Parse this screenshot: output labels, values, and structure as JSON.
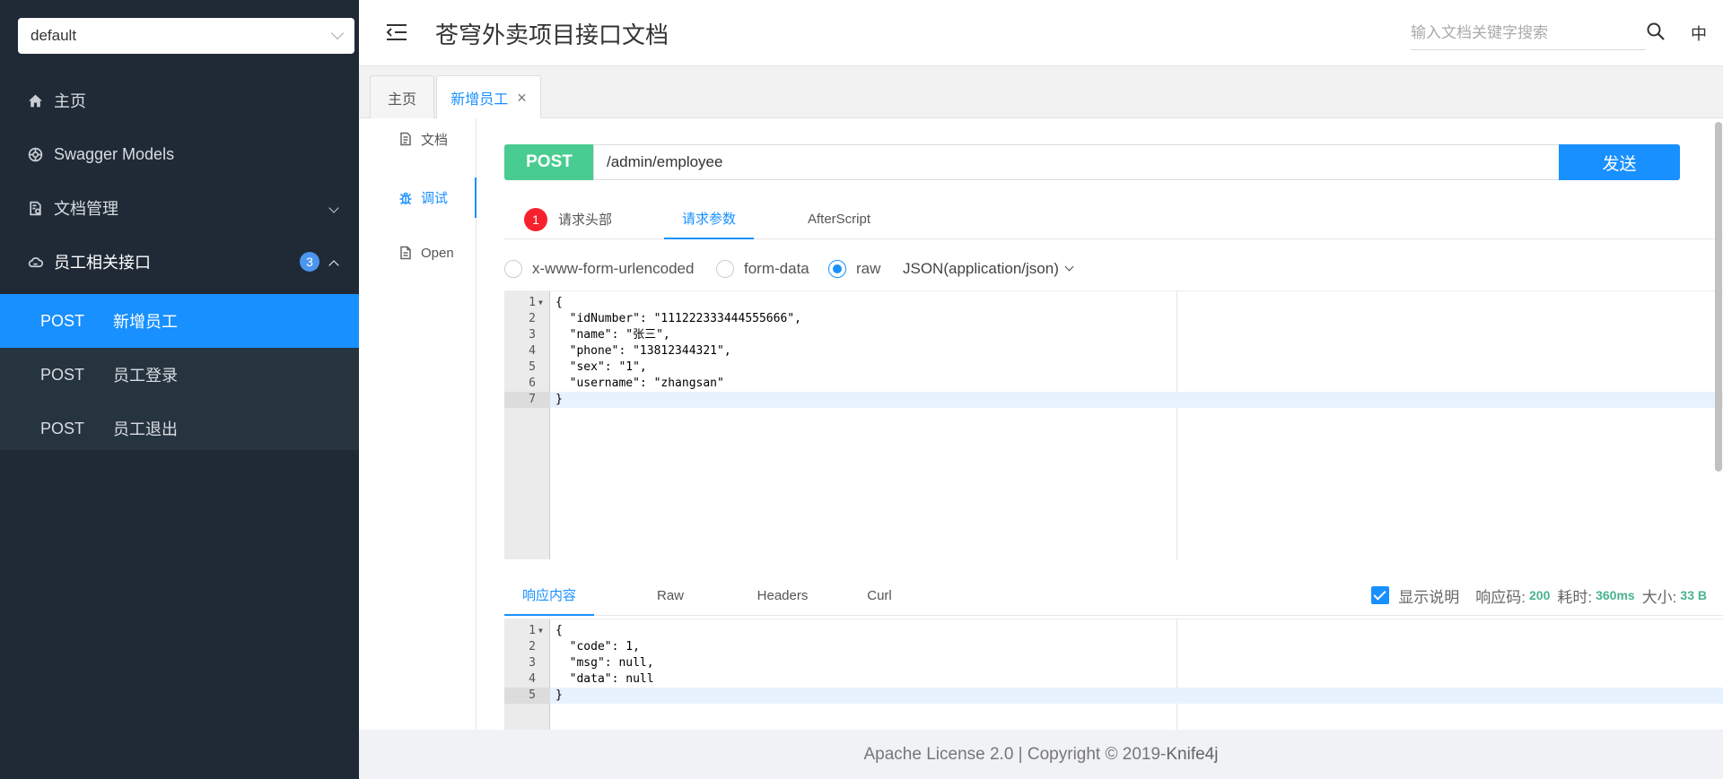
{
  "sidebar": {
    "group_select": "default",
    "nav": [
      {
        "label": "主页",
        "icon": "home-icon"
      },
      {
        "label": "Swagger Models",
        "icon": "models-icon"
      },
      {
        "label": "文档管理",
        "icon": "doc-manage-icon"
      },
      {
        "label": "员工相关接口",
        "icon": "cloud-icon",
        "badge": "3"
      }
    ],
    "endpoints": [
      {
        "method": "POST",
        "label": "新增员工"
      },
      {
        "method": "POST",
        "label": "员工登录"
      },
      {
        "method": "POST",
        "label": "员工退出"
      }
    ]
  },
  "header": {
    "title": "苍穹外卖项目接口文档",
    "search_placeholder": "输入文档关键字搜索",
    "lang": "中"
  },
  "tabs": [
    {
      "label": "主页"
    },
    {
      "label": "新增员工",
      "close": "×"
    }
  ],
  "side_tabs": [
    {
      "label": "文档"
    },
    {
      "label": "调试"
    },
    {
      "label": "Open"
    }
  ],
  "request": {
    "method": "POST",
    "url": "/admin/employee",
    "send_label": "发送",
    "tabs": [
      {
        "label": "请求头部",
        "badge": "1"
      },
      {
        "label": "请求参数"
      },
      {
        "label": "AfterScript"
      }
    ],
    "body_types": [
      "x-www-form-urlencoded",
      "form-data",
      "raw"
    ],
    "content_type": "JSON(application/json)",
    "body_lines": [
      "{",
      "  \"idNumber\": \"111222333444555666\",",
      "  \"name\": \"张三\",",
      "  \"phone\": \"13812344321\",",
      "  \"sex\": \"1\",",
      "  \"username\": \"zhangsan\"",
      "}"
    ]
  },
  "response": {
    "tabs": [
      "响应内容",
      "Raw",
      "Headers",
      "Curl"
    ],
    "show_desc_label": "显示说明",
    "status_label": "响应码:",
    "status_value": "200",
    "time_label": "耗时:",
    "time_value": "360ms",
    "size_label": "大小:",
    "size_value": "33 B",
    "body_lines": [
      "{",
      "  \"code\": 1,",
      "  \"msg\": null,",
      "  \"data\": null",
      "}"
    ]
  },
  "footer": {
    "text": "Apache License 2.0 | Copyright ",
    "copyright_symbol": "©",
    "year": " 2019-",
    "brand": "Knife4j"
  }
}
